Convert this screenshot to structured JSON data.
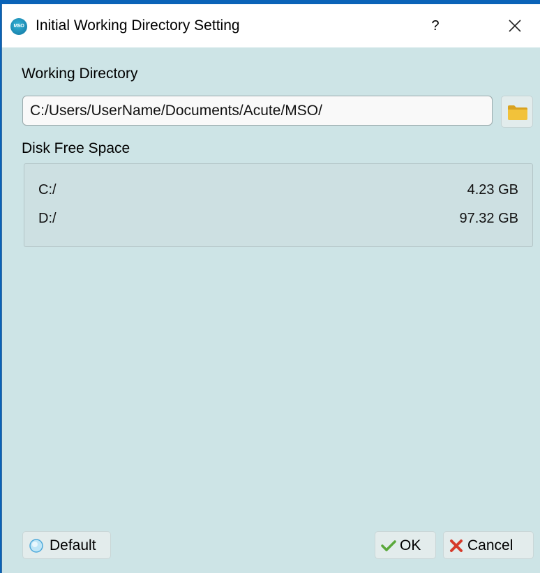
{
  "dialog": {
    "title": "Initial Working Directory Setting",
    "app_icon_text": "MSO",
    "help_label": "?",
    "close_icon": "close-icon"
  },
  "working_directory": {
    "label": "Working Directory",
    "value": "C:/Users/UserName/Documents/Acute/MSO/",
    "browse_icon": "folder-icon"
  },
  "disk_free_space": {
    "label": "Disk Free Space",
    "drives": [
      {
        "name": "C:/",
        "free": "4.23 GB"
      },
      {
        "name": "D:/",
        "free": "97.32 GB"
      }
    ]
  },
  "buttons": {
    "default_label": "Default",
    "ok_label": "OK",
    "cancel_label": "Cancel"
  },
  "colors": {
    "dialog_background": "#cde4e6",
    "ok_check": "#5aa83a",
    "cancel_x": "#d63a2a",
    "folder": "#f2c23a"
  }
}
